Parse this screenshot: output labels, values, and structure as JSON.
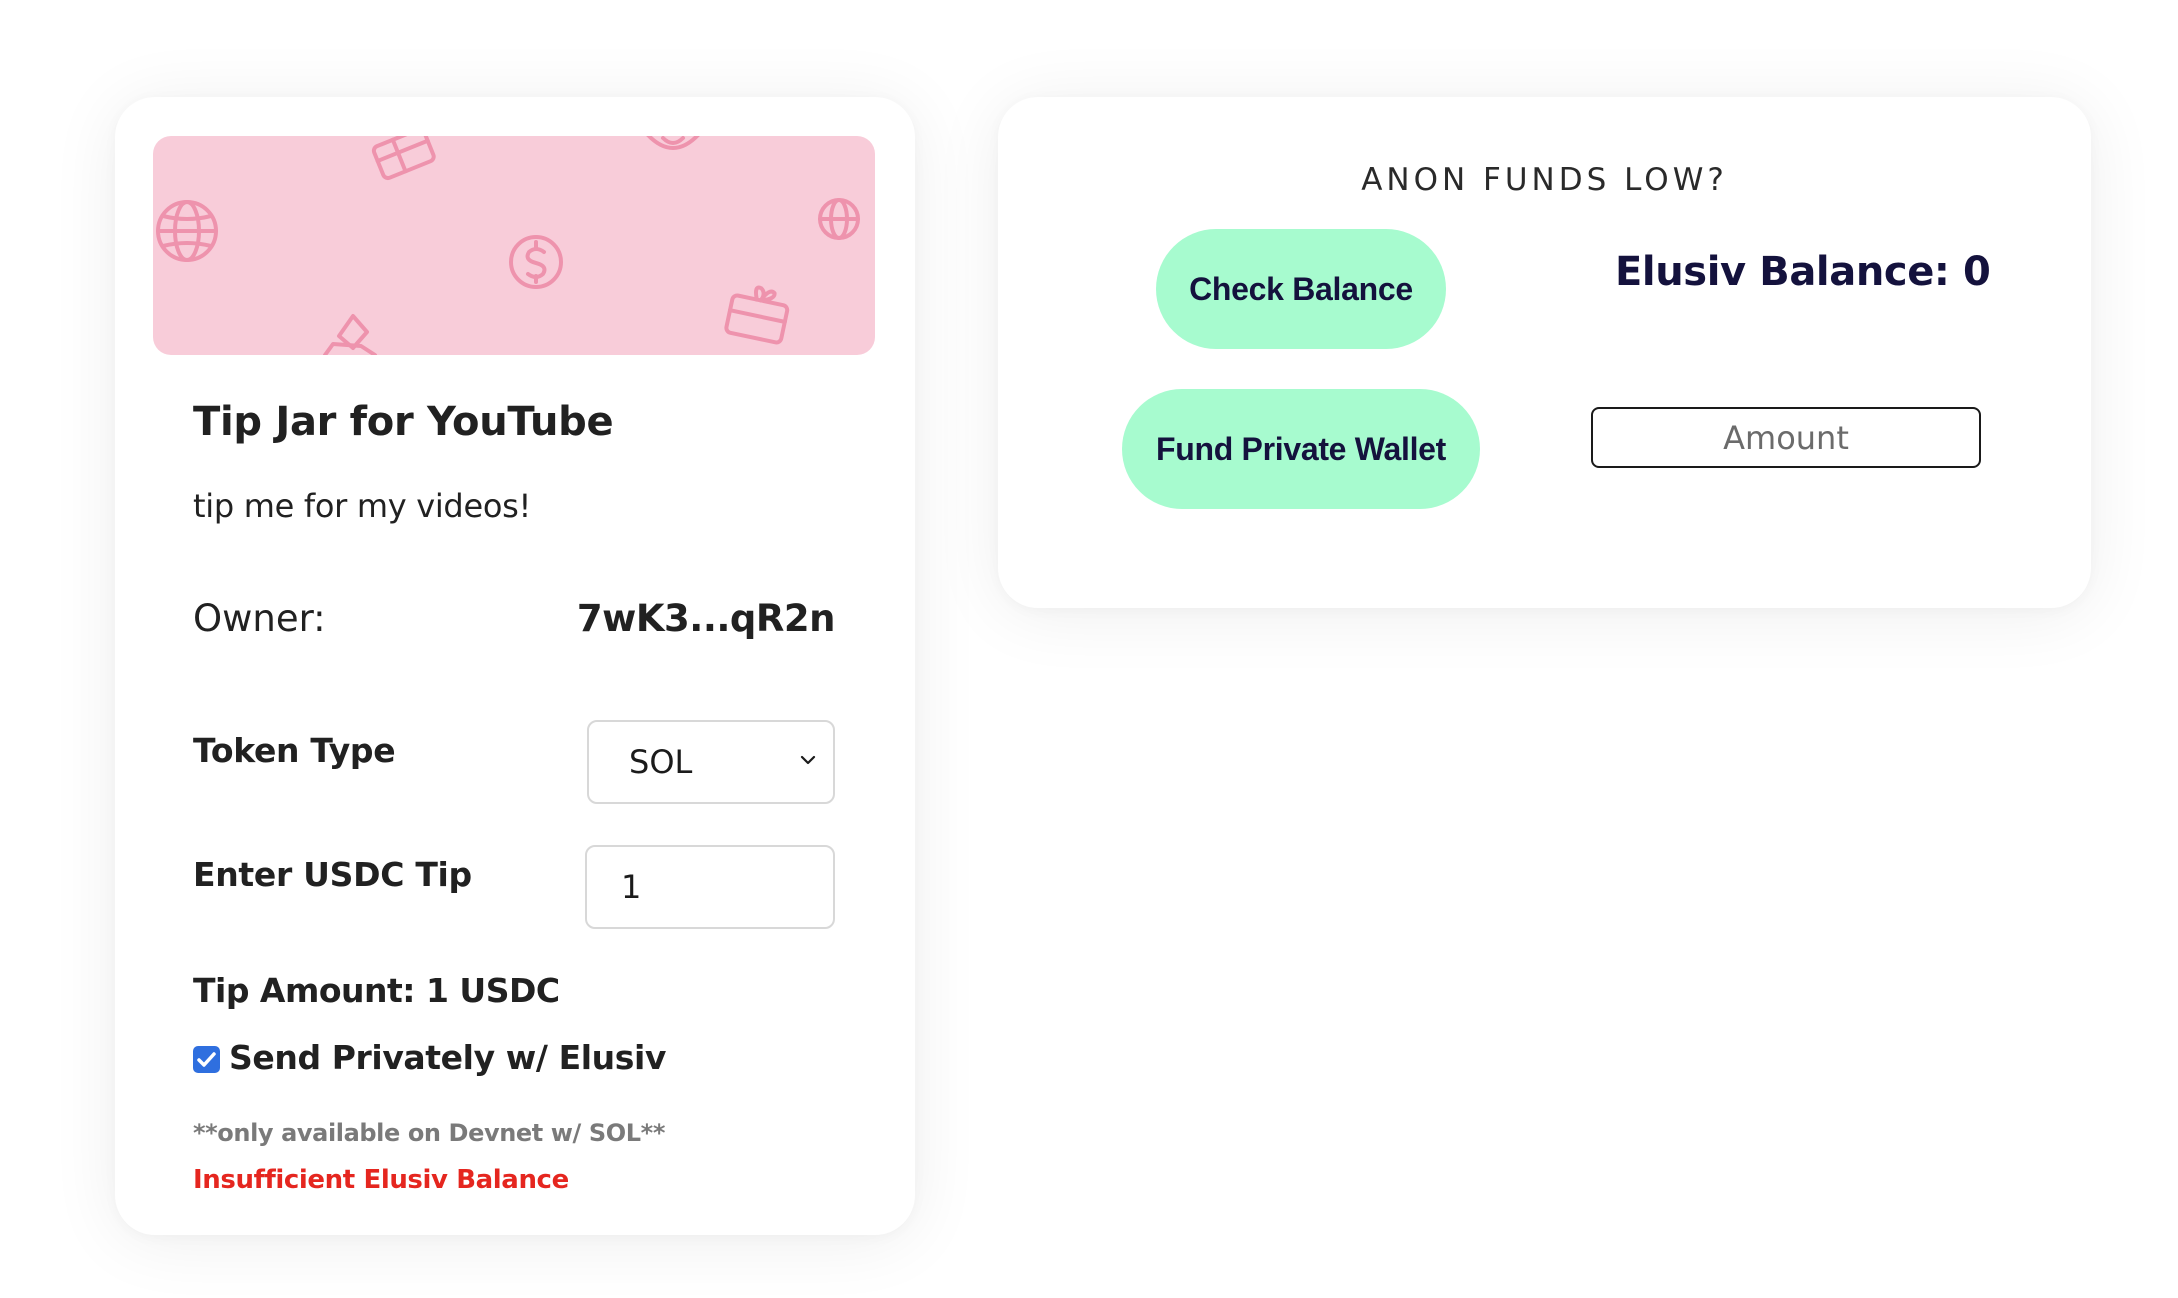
{
  "tip_jar": {
    "title": "Tip Jar for YouTube",
    "description": "tip me for my videos!",
    "owner_label": "Owner:",
    "owner_value": "7wK3...qR2n",
    "token_type_label": "Token Type",
    "token_type_selected": "SOL",
    "tip_input_label": "Enter USDC Tip",
    "tip_input_value": "1",
    "tip_amount_text": "Tip Amount: 1 USDC",
    "send_privately_label": "Send Privately w/ Elusiv",
    "send_privately_checked": true,
    "note": "**only available on Devnet w/ SOL**",
    "error": "Insufficient Elusiv Balance",
    "banner_color": "#f8ccd9",
    "banner_icon_color": "#ee93ad",
    "banner_icons": [
      "globe-icon",
      "gift-card-icon",
      "dollar-coin-icon",
      "gift-card-icon",
      "globe-icon",
      "diamond-hand-icon"
    ]
  },
  "fund": {
    "title": "ANON FUNDS LOW?",
    "check_balance_label": "Check Balance",
    "balance_text": "Elusiv Balance: 0",
    "fund_wallet_label": "Fund Private Wallet",
    "amount_placeholder": "Amount",
    "button_color": "#a7fbcf",
    "text_color": "#14123d"
  }
}
